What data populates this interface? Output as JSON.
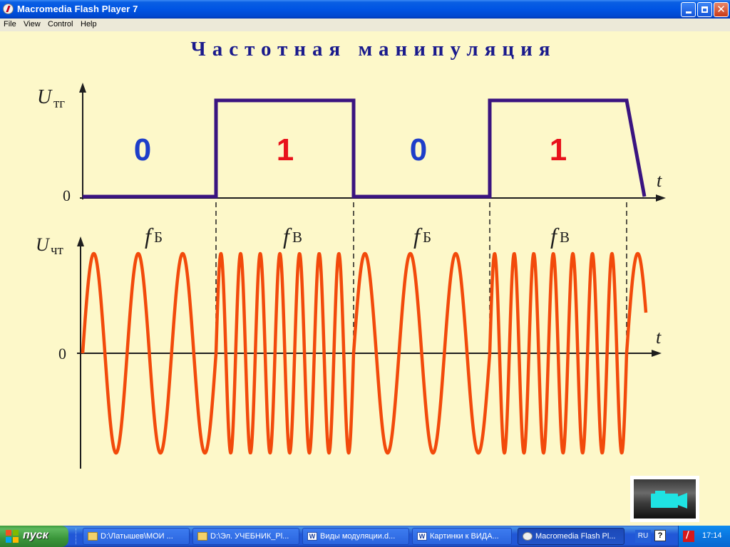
{
  "window": {
    "title": "Macromedia Flash Player 7",
    "menu": [
      "File",
      "View",
      "Control",
      "Help"
    ]
  },
  "slide": {
    "heading": "Частотная манипуляция",
    "top_graph": {
      "y_symbol": "U",
      "y_subscript": "тг",
      "zero_label": "0",
      "x_symbol": "t",
      "bit_labels": [
        "0",
        "1",
        "0",
        "1"
      ],
      "bits": [
        0,
        1,
        0,
        1
      ]
    },
    "bottom_graph": {
      "y_symbol": "U",
      "y_subscript": "чт",
      "zero_label": "0",
      "x_symbol": "t",
      "freq_labels": [
        {
          "f": "f",
          "sub": "Б"
        },
        {
          "f": "f",
          "sub": "В"
        },
        {
          "f": "f",
          "sub": "Б"
        },
        {
          "f": "f",
          "sub": "В"
        }
      ],
      "cycles_per_bit": [
        3,
        7,
        3,
        7
      ]
    },
    "colors": {
      "heading": "#1a1a8c",
      "bit_zero": "#1e3ec9",
      "bit_one": "#e8121b",
      "square_wave": "#3a1480",
      "fm_wave": "#f24a0b",
      "axis": "#1e1e1e",
      "background": "#fdf8c9"
    },
    "play_button_icon": "camera-icon"
  },
  "taskbar": {
    "start_label": "пуск",
    "tasks": [
      {
        "label": "D:\\Латышев\\МОИ ...",
        "icon": "folder-icon"
      },
      {
        "label": "D:\\Эл. УЧЕБНИК_Pl...",
        "icon": "folder-icon"
      },
      {
        "label": "Виды модуляции.d...",
        "icon": "word-doc-icon"
      },
      {
        "label": "Картинки к ВИДА...",
        "icon": "word-doc-icon"
      },
      {
        "label": "Macromedia Flash Pl...",
        "icon": "flash-icon",
        "active": true
      }
    ],
    "language": "RU",
    "help": "?",
    "clock": "17:14"
  }
}
